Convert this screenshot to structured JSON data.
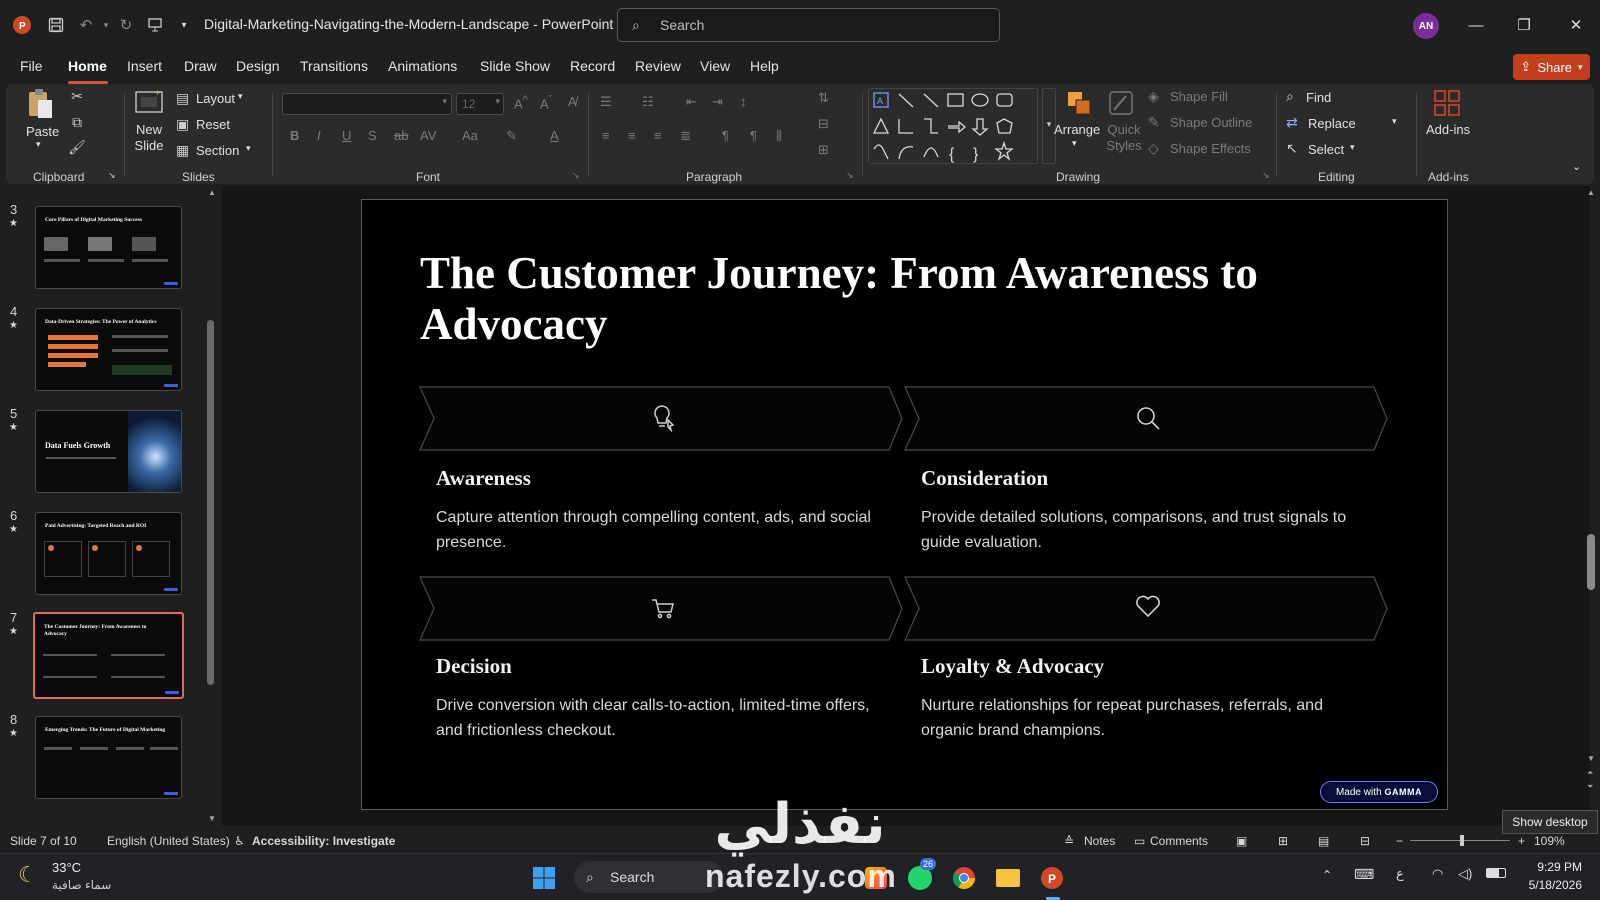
{
  "app": {
    "title": "Digital-Marketing-Navigating-the-Modern-Landscape - PowerPoint",
    "search_placeholder": "Search",
    "avatar_initials": "AN",
    "share_label": "Share"
  },
  "menu": [
    "File",
    "Home",
    "Insert",
    "Draw",
    "Design",
    "Transitions",
    "Animations",
    "Slide Show",
    "Record",
    "Review",
    "View",
    "Help"
  ],
  "ribbon": {
    "clipboard": {
      "paste": "Paste",
      "label": "Clipboard"
    },
    "slides": {
      "new_slide": "New\nSlide",
      "layout": "Layout",
      "reset": "Reset",
      "section": "Section",
      "label": "Slides"
    },
    "font": {
      "size": "12",
      "label": "Font"
    },
    "paragraph": {
      "label": "Paragraph"
    },
    "drawing": {
      "arrange": "Arrange",
      "quick_styles": "Quick Styles",
      "shape_fill": "Shape Fill",
      "shape_outline": "Shape Outline",
      "shape_effects": "Shape Effects",
      "label": "Drawing"
    },
    "editing": {
      "find": "Find",
      "replace": "Replace",
      "select": "Select",
      "label": "Editing"
    },
    "addins": {
      "button": "Add-ins",
      "label": "Add-ins"
    }
  },
  "thumbnails": [
    {
      "num": "3",
      "title": "Core Pillars of Digital Marketing Success"
    },
    {
      "num": "4",
      "title": "Data-Driven Strategies: The Power of Analytics"
    },
    {
      "num": "5",
      "title": "Data Fuels Growth"
    },
    {
      "num": "6",
      "title": "Paid Advertising: Targeted Reach and ROI"
    },
    {
      "num": "7",
      "title": "The Customer Journey: From Awareness to Advocacy"
    },
    {
      "num": "8",
      "title": "Emerging Trends: The Future of Digital Marketing"
    }
  ],
  "slide": {
    "title": "The Customer Journey: From Awareness to Advocacy",
    "stages": [
      {
        "icon": "lightbulb-icon",
        "heading": "Awareness",
        "text": "Capture attention through compelling content, ads, and social presence."
      },
      {
        "icon": "magnifier-icon",
        "heading": "Consideration",
        "text": "Provide detailed solutions, comparisons, and trust signals to guide evaluation."
      },
      {
        "icon": "cart-icon",
        "heading": "Decision",
        "text": "Drive conversion with clear calls-to-action, limited-time offers, and frictionless checkout."
      },
      {
        "icon": "heart-icon",
        "heading": "Loyalty & Advocacy",
        "text": "Nurture relationships for repeat purchases, referrals, and organic brand champions."
      }
    ],
    "badge_prefix": "Made with",
    "badge_brand": "GAMMA"
  },
  "status": {
    "slide_count": "Slide 7 of 10",
    "language": "English (United States)",
    "accessibility": "Accessibility: Investigate",
    "notes": "Notes",
    "comments": "Comments",
    "zoom": "109%"
  },
  "tooltip": "Show desktop",
  "taskbar": {
    "temperature": "33°C",
    "weather": "سماء صافية",
    "search": "Search",
    "time": "9:29 PM",
    "date": "5/18/2026",
    "whatsapp_badge": "26"
  },
  "watermark": {
    "arabic": "نفذلي",
    "site": "nafezly.com"
  },
  "colors": {
    "accent": "#c43e1c",
    "selection": "#e36a5a",
    "gamma": "#6f7bff"
  }
}
